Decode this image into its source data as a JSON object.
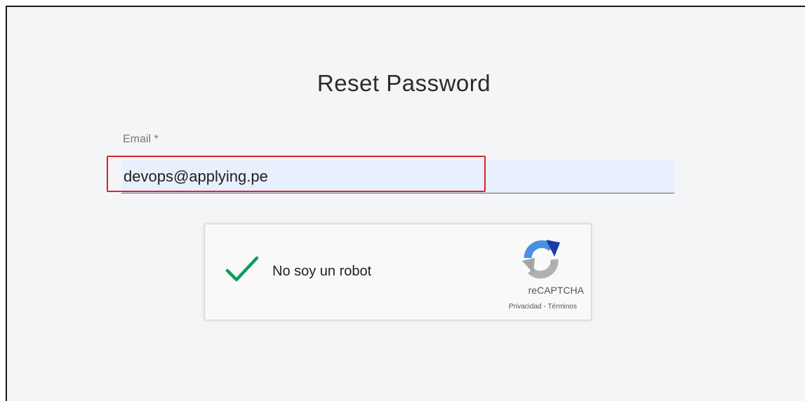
{
  "page": {
    "title": "Reset Password"
  },
  "form": {
    "email_label": "Email *",
    "email_value": "devops@applying.pe"
  },
  "recaptcha": {
    "label": "No soy un robot",
    "checked": true,
    "brand": "reCAPTCHA",
    "privacy_link": "Privacidad",
    "separator": " - ",
    "terms_link": "Términos",
    "check_color": "#0f9d58"
  },
  "colors": {
    "highlight_border": "#e0202e",
    "input_autofill_bg": "#e8f0fe"
  }
}
